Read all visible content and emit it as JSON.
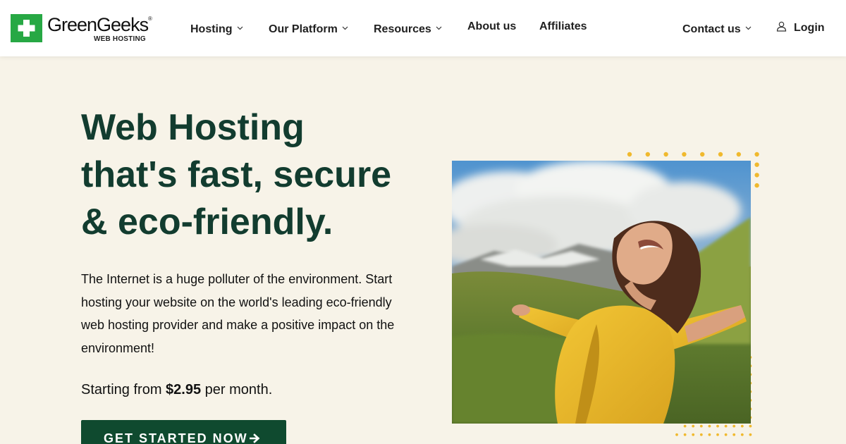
{
  "brand": {
    "name": "GreenGeeks",
    "registered": "®",
    "subtitle": "WEB HOSTING",
    "logo_color": "#27a844"
  },
  "nav": {
    "hosting": "Hosting",
    "platform": "Our Platform",
    "resources": "Resources",
    "about": "About us",
    "affiliates": "Affiliates",
    "contact": "Contact us",
    "login": "Login"
  },
  "hero": {
    "title_lines": [
      "Web Hosting",
      "that's fast, secure",
      "& eco-friendly."
    ],
    "description": "The Internet is a huge polluter of the environment. Start hosting your website on the world's leading eco-friendly web hosting provider and make a positive impact on the environment!",
    "price_prefix": "Starting from ",
    "price": "$2.95",
    "price_suffix": " per month.",
    "cta_label": "GET STARTED NOW"
  },
  "colors": {
    "background": "#f7f3e8",
    "heading": "#123c2f",
    "button": "#0f4a2f",
    "dots": "#f0b92e"
  },
  "icons": {
    "logo_mark": "plus-icon",
    "dropdown": "chevron-down-icon",
    "login": "user-icon",
    "cta": "arrow-right-icon"
  }
}
